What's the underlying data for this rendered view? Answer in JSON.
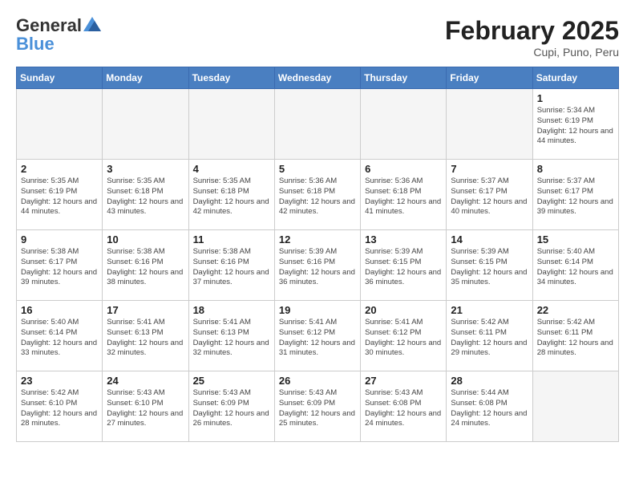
{
  "header": {
    "logo_general": "General",
    "logo_blue": "Blue",
    "month_title": "February 2025",
    "location": "Cupi, Puno, Peru"
  },
  "weekdays": [
    "Sunday",
    "Monday",
    "Tuesday",
    "Wednesday",
    "Thursday",
    "Friday",
    "Saturday"
  ],
  "weeks": [
    [
      {
        "day": "",
        "info": ""
      },
      {
        "day": "",
        "info": ""
      },
      {
        "day": "",
        "info": ""
      },
      {
        "day": "",
        "info": ""
      },
      {
        "day": "",
        "info": ""
      },
      {
        "day": "",
        "info": ""
      },
      {
        "day": "1",
        "info": "Sunrise: 5:34 AM\nSunset: 6:19 PM\nDaylight: 12 hours and 44 minutes."
      }
    ],
    [
      {
        "day": "2",
        "info": "Sunrise: 5:35 AM\nSunset: 6:19 PM\nDaylight: 12 hours and 44 minutes."
      },
      {
        "day": "3",
        "info": "Sunrise: 5:35 AM\nSunset: 6:18 PM\nDaylight: 12 hours and 43 minutes."
      },
      {
        "day": "4",
        "info": "Sunrise: 5:35 AM\nSunset: 6:18 PM\nDaylight: 12 hours and 42 minutes."
      },
      {
        "day": "5",
        "info": "Sunrise: 5:36 AM\nSunset: 6:18 PM\nDaylight: 12 hours and 42 minutes."
      },
      {
        "day": "6",
        "info": "Sunrise: 5:36 AM\nSunset: 6:18 PM\nDaylight: 12 hours and 41 minutes."
      },
      {
        "day": "7",
        "info": "Sunrise: 5:37 AM\nSunset: 6:17 PM\nDaylight: 12 hours and 40 minutes."
      },
      {
        "day": "8",
        "info": "Sunrise: 5:37 AM\nSunset: 6:17 PM\nDaylight: 12 hours and 39 minutes."
      }
    ],
    [
      {
        "day": "9",
        "info": "Sunrise: 5:38 AM\nSunset: 6:17 PM\nDaylight: 12 hours and 39 minutes."
      },
      {
        "day": "10",
        "info": "Sunrise: 5:38 AM\nSunset: 6:16 PM\nDaylight: 12 hours and 38 minutes."
      },
      {
        "day": "11",
        "info": "Sunrise: 5:38 AM\nSunset: 6:16 PM\nDaylight: 12 hours and 37 minutes."
      },
      {
        "day": "12",
        "info": "Sunrise: 5:39 AM\nSunset: 6:16 PM\nDaylight: 12 hours and 36 minutes."
      },
      {
        "day": "13",
        "info": "Sunrise: 5:39 AM\nSunset: 6:15 PM\nDaylight: 12 hours and 36 minutes."
      },
      {
        "day": "14",
        "info": "Sunrise: 5:39 AM\nSunset: 6:15 PM\nDaylight: 12 hours and 35 minutes."
      },
      {
        "day": "15",
        "info": "Sunrise: 5:40 AM\nSunset: 6:14 PM\nDaylight: 12 hours and 34 minutes."
      }
    ],
    [
      {
        "day": "16",
        "info": "Sunrise: 5:40 AM\nSunset: 6:14 PM\nDaylight: 12 hours and 33 minutes."
      },
      {
        "day": "17",
        "info": "Sunrise: 5:41 AM\nSunset: 6:13 PM\nDaylight: 12 hours and 32 minutes."
      },
      {
        "day": "18",
        "info": "Sunrise: 5:41 AM\nSunset: 6:13 PM\nDaylight: 12 hours and 32 minutes."
      },
      {
        "day": "19",
        "info": "Sunrise: 5:41 AM\nSunset: 6:12 PM\nDaylight: 12 hours and 31 minutes."
      },
      {
        "day": "20",
        "info": "Sunrise: 5:41 AM\nSunset: 6:12 PM\nDaylight: 12 hours and 30 minutes."
      },
      {
        "day": "21",
        "info": "Sunrise: 5:42 AM\nSunset: 6:11 PM\nDaylight: 12 hours and 29 minutes."
      },
      {
        "day": "22",
        "info": "Sunrise: 5:42 AM\nSunset: 6:11 PM\nDaylight: 12 hours and 28 minutes."
      }
    ],
    [
      {
        "day": "23",
        "info": "Sunrise: 5:42 AM\nSunset: 6:10 PM\nDaylight: 12 hours and 28 minutes."
      },
      {
        "day": "24",
        "info": "Sunrise: 5:43 AM\nSunset: 6:10 PM\nDaylight: 12 hours and 27 minutes."
      },
      {
        "day": "25",
        "info": "Sunrise: 5:43 AM\nSunset: 6:09 PM\nDaylight: 12 hours and 26 minutes."
      },
      {
        "day": "26",
        "info": "Sunrise: 5:43 AM\nSunset: 6:09 PM\nDaylight: 12 hours and 25 minutes."
      },
      {
        "day": "27",
        "info": "Sunrise: 5:43 AM\nSunset: 6:08 PM\nDaylight: 12 hours and 24 minutes."
      },
      {
        "day": "28",
        "info": "Sunrise: 5:44 AM\nSunset: 6:08 PM\nDaylight: 12 hours and 24 minutes."
      },
      {
        "day": "",
        "info": ""
      }
    ]
  ]
}
